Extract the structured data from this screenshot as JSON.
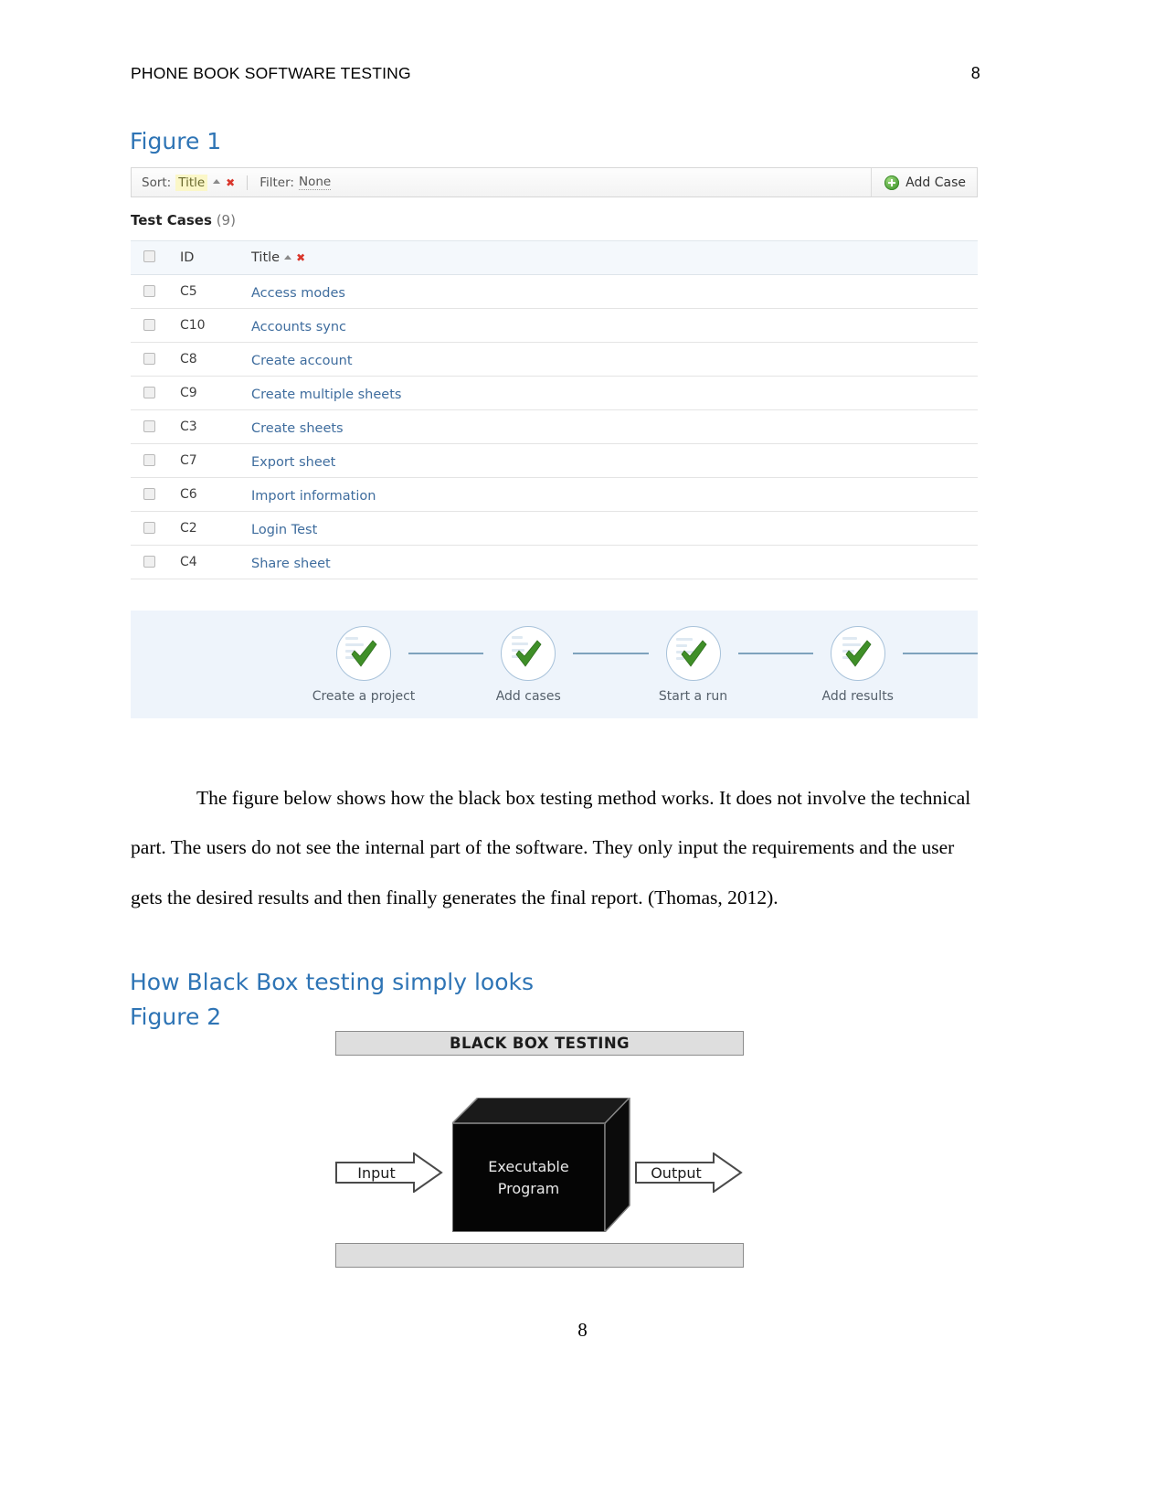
{
  "running_head": {
    "title": "PHONE BOOK SOFTWARE TESTING",
    "page_number": "8"
  },
  "headings": {
    "figure1": "Figure 1",
    "section": "How Black Box testing simply looks",
    "figure2": "Figure 2"
  },
  "testrail": {
    "toolbar": {
      "sort_label": "Sort:",
      "sort_value": "Title",
      "sort_direction_icon": "caret-up-icon",
      "sort_clear_icon": "red-x-icon",
      "filter_label": "Filter:",
      "filter_value": "None",
      "add_case_label": "Add Case",
      "add_case_icon": "plus-circle-green-icon"
    },
    "section_title": "Test Cases",
    "section_count": "(9)",
    "columns": [
      "",
      "ID",
      "Title"
    ],
    "title_column_sort_icon": "caret-up-icon",
    "title_column_clear_icon": "red-x-icon",
    "rows": [
      {
        "id": "C5",
        "title": "Access modes"
      },
      {
        "id": "C10",
        "title": "Accounts sync"
      },
      {
        "id": "C8",
        "title": "Create account"
      },
      {
        "id": "C9",
        "title": "Create multiple sheets"
      },
      {
        "id": "C3",
        "title": "Create sheets"
      },
      {
        "id": "C7",
        "title": "Export sheet"
      },
      {
        "id": "C6",
        "title": "Import information"
      },
      {
        "id": "C2",
        "title": "Login Test"
      },
      {
        "id": "C4",
        "title": "Share sheet"
      }
    ],
    "workflow": {
      "steps": [
        {
          "label": "Create a project",
          "icon": "green-check-icon"
        },
        {
          "label": "Add cases",
          "icon": "green-check-icon"
        },
        {
          "label": "Start a run",
          "icon": "green-check-icon"
        },
        {
          "label": "Add results",
          "icon": "green-check-icon"
        }
      ]
    }
  },
  "paragraph": "The figure below shows how the black box testing method works. It does not involve the technical part. The users do not see the internal part of the software. They only input the requirements and the user gets the desired results and then finally generates the final report. (Thomas, 2012).",
  "blackbox_figure": {
    "title_bar": "BLACK BOX TESTING",
    "input_label": "Input",
    "box_label_line1": "Executable",
    "box_label_line2": "Program",
    "output_label": "Output",
    "bottom_bar": ""
  },
  "footer": {
    "page_number": "8"
  },
  "colors": {
    "heading_blue": "#2e74b5",
    "link_blue": "#3f6d9e",
    "workflow_bg": "#eef4fb",
    "check_green": "#3f8f28",
    "accent_red": "#d9362b"
  }
}
